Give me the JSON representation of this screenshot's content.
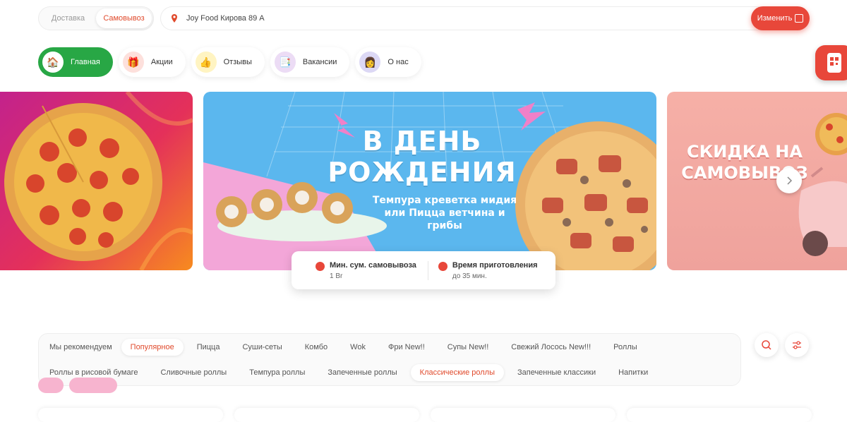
{
  "header": {
    "modes": [
      {
        "label": "Доставка",
        "active": false
      },
      {
        "label": "Самовывоз",
        "active": true
      }
    ],
    "address": "Joy Food Кирова 89 А",
    "change_label": "Изменить"
  },
  "nav": [
    {
      "label": "Главная",
      "icon": "home-icon",
      "glyph": "🏠",
      "active": true
    },
    {
      "label": "Акции",
      "icon": "gift-icon",
      "glyph": "🎁",
      "active": false
    },
    {
      "label": "Отзывы",
      "icon": "thumbs-up-icon",
      "glyph": "👍",
      "active": false
    },
    {
      "label": "Вакансии",
      "icon": "document-icon",
      "glyph": "📑",
      "active": false
    },
    {
      "label": "О нас",
      "icon": "person-icon",
      "glyph": "👩",
      "active": false
    }
  ],
  "banners": {
    "center_title": "В ДЕНЬ РОЖДЕНИЯ",
    "center_subtitle": "Темпура креветка мидия или Пицца ветчина и грибы",
    "right_title": "СКИДКА НА САМОВЫВОЗ"
  },
  "info": {
    "min_label": "Мин. сум. самовывоза",
    "min_value": "1 Br",
    "time_label": "Время приготовления",
    "time_value": "до 35 мин."
  },
  "categories": {
    "row1": [
      "Мы рекомендуем",
      "Популярное",
      "Пицца",
      "Суши-сеты",
      "Комбо",
      "Wok",
      "Фри New!!",
      "Супы New!!",
      "Свежий Лосось New!!!",
      "Роллы"
    ],
    "row2": [
      "Роллы в рисовой бумаге",
      "Сливочные роллы",
      "Темпура роллы",
      "Запеченные роллы",
      "Классические роллы",
      "Запеченные классики",
      "Напитки"
    ],
    "active_row1": "Популярное",
    "active_row2": "Классические роллы"
  },
  "colors": {
    "accent": "#e8473a",
    "active_nav": "#28a745",
    "banner_sky": "#5bb7ee"
  }
}
